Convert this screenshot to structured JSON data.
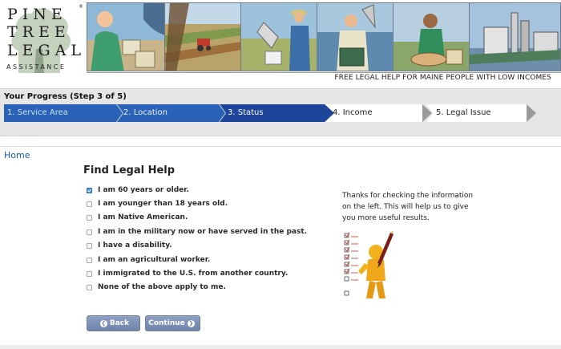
{
  "header": {
    "logo": {
      "line1": "PINE",
      "line2": "TREE",
      "line3": "LEGAL",
      "line4": "ASSISTANCE",
      "registered": "®"
    },
    "tagline": "FREE LEGAL HELP FOR MAINE PEOPLE WITH LOW INCOMES"
  },
  "progress": {
    "title": "Your Progress (Step 3 of 5)",
    "steps": [
      {
        "label": "1. Service Area",
        "state": "completed"
      },
      {
        "label": "2. Location",
        "state": "completed"
      },
      {
        "label": "3. Status",
        "state": "current"
      },
      {
        "label": "4. Income",
        "state": "upcoming"
      },
      {
        "label": "5. Legal Issue",
        "state": "upcoming"
      }
    ]
  },
  "nav": {
    "home": "Home"
  },
  "form": {
    "title": "Find Legal Help",
    "options": [
      {
        "label": "I am 60 years or older.",
        "checked": true
      },
      {
        "label": "I am younger than 18 years old.",
        "checked": false
      },
      {
        "label": "I am Native American.",
        "checked": false
      },
      {
        "label": "I am in the military now or have served in the past.",
        "checked": false
      },
      {
        "label": "I have a disability.",
        "checked": false
      },
      {
        "label": "I am an agricultural worker.",
        "checked": false
      },
      {
        "label": "I immigrated to the U.S. from another country.",
        "checked": false
      },
      {
        "label": "None of the above apply to me.",
        "checked": false
      }
    ],
    "back_label": "Back",
    "continue_label": "Continue"
  },
  "info": {
    "text": "Thanks for checking the information on the left. This will help us to give you more useful results."
  },
  "colors": {
    "progress_dark": "#1f4fa0",
    "progress_mid": "#2e6cc4",
    "link": "#1a5aa8",
    "button": "#7c8fb4"
  }
}
